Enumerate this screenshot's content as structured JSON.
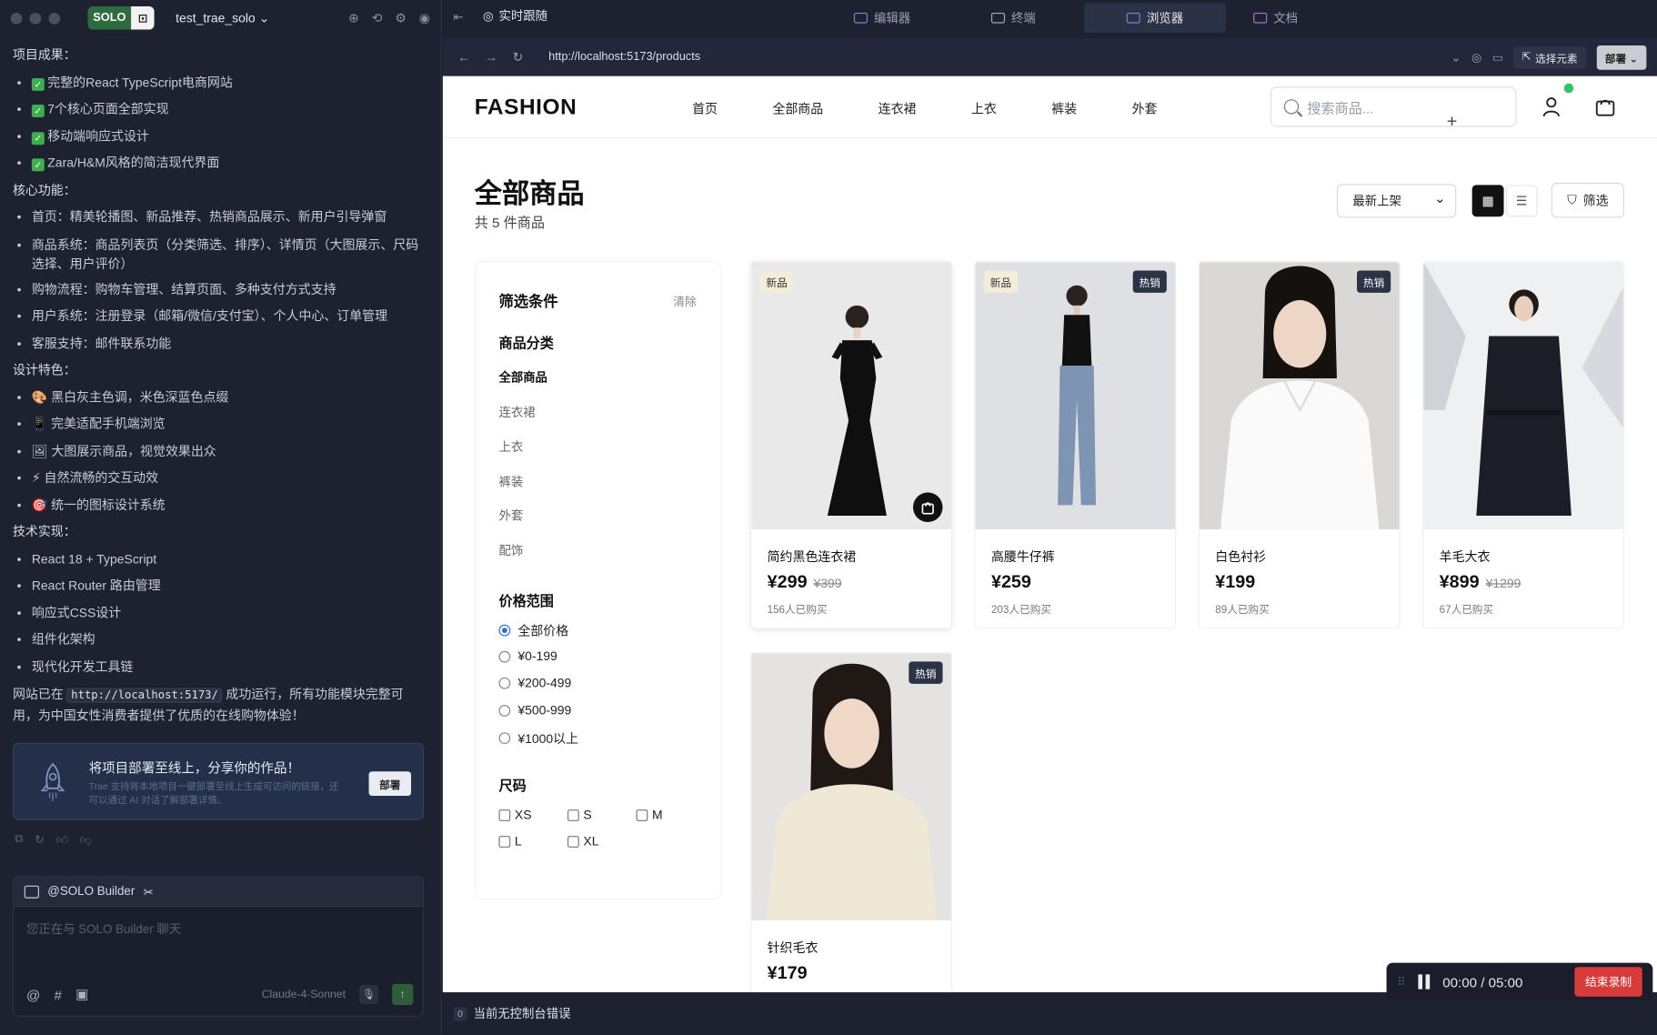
{
  "left_panel": {
    "app_badge": "SOLO",
    "project_name": "test_trae_solo",
    "sections": {
      "results_title": "项目成果：",
      "results": [
        "完整的React TypeScript电商网站",
        "7个核心页面全部实现",
        "移动端响应式设计",
        "Zara/H&M风格的简洁现代界面"
      ],
      "features_title": "核心功能：",
      "features": [
        "首页：精美轮播图、新品推荐、热销商品展示、新用户引导弹窗",
        "商品系统：商品列表页（分类筛选、排序）、详情页（大图展示、尺码选择、用户评价）",
        "购物流程：购物车管理、结算页面、多种支付方式支持",
        "用户系统：注册登录（邮箱/微信/支付宝）、个人中心、订单管理",
        "客服支持：邮件联系功能"
      ],
      "design_title": "设计特色：",
      "design": [
        {
          "emoji": "🎨",
          "text": "黑白灰主色调，米色深蓝色点缀"
        },
        {
          "emoji": "📱",
          "text": "完美适配手机端浏览"
        },
        {
          "emoji": "🖼",
          "text": "大图展示商品，视觉效果出众"
        },
        {
          "emoji": "⚡",
          "text": "自然流畅的交互动效"
        },
        {
          "emoji": "🎯",
          "text": "统一的图标设计系统"
        }
      ],
      "tech_title": "技术实现：",
      "tech": [
        "React 18 + TypeScript",
        "React Router 路由管理",
        "响应式CSS设计",
        "组件化架构",
        "现代化开发工具链"
      ],
      "summary_pre": "网站已在",
      "summary_code": "http://localhost:5173/",
      "summary_post": "成功运行，所有功能模块完整可用，为中国女性消费者提供了优质的在线购物体验！"
    },
    "deploy_card": {
      "title": "将项目部署至线上，分享你的作品！",
      "subtitle": "Trae 支持将本地项目一键部署至线上生成可访问的链接，还可以通过 AI 对话了解部署详情。",
      "button": "部署"
    },
    "chat": {
      "agent": "@SOLO Builder",
      "placeholder": "您正在与 SOLO Builder 聊天",
      "model": "Claude-4-Sonnet"
    }
  },
  "tabs": {
    "realtime": "实时跟随",
    "editor": "编辑器",
    "terminal": "终端",
    "browser": "浏览器",
    "docs": "文档"
  },
  "browser": {
    "url": "http://localhost:5173/products",
    "select_element": "选择元素",
    "deploy": "部署"
  },
  "site": {
    "logo": "FASHION",
    "nav": [
      "首页",
      "全部商品",
      "连衣裙",
      "上衣",
      "裤装",
      "外套"
    ],
    "search_placeholder": "搜索商品...",
    "page_title": "全部商品",
    "count": "共 5 件商品",
    "sort": "最新上架",
    "filter_button": "筛选",
    "filters": {
      "title": "筛选条件",
      "clear": "清除",
      "category_title": "商品分类",
      "categories": [
        "全部商品",
        "连衣裙",
        "上衣",
        "裤装",
        "外套",
        "配饰"
      ],
      "price_title": "价格范围",
      "prices": [
        "全部价格",
        "¥0-199",
        "¥200-499",
        "¥500-999",
        "¥1000以上"
      ],
      "size_title": "尺码",
      "sizes": [
        "XS",
        "S",
        "M",
        "L",
        "XL"
      ]
    },
    "products": [
      {
        "name": "简约黑色连衣裙",
        "price": "¥299",
        "old": "¥399",
        "sold": "156人已购买",
        "badges": [
          "新品"
        ]
      },
      {
        "name": "高腰牛仔裤",
        "price": "¥259",
        "old": "",
        "sold": "203人已购买",
        "badges": [
          "新品",
          "热销"
        ]
      },
      {
        "name": "白色衬衫",
        "price": "¥199",
        "old": "",
        "sold": "89人已购买",
        "badges": [
          "热销"
        ]
      },
      {
        "name": "羊毛大衣",
        "price": "¥899",
        "old": "¥1299",
        "sold": "67人已购买",
        "badges": []
      },
      {
        "name": "针织毛衣",
        "price": "¥179",
        "old": "",
        "sold": "",
        "badges": [
          "热销"
        ]
      }
    ]
  },
  "status": {
    "errors": "0",
    "console": "当前无控制台错误"
  },
  "recorder": {
    "time": "00:00",
    "total": "05:00",
    "stop": "结束录制"
  }
}
